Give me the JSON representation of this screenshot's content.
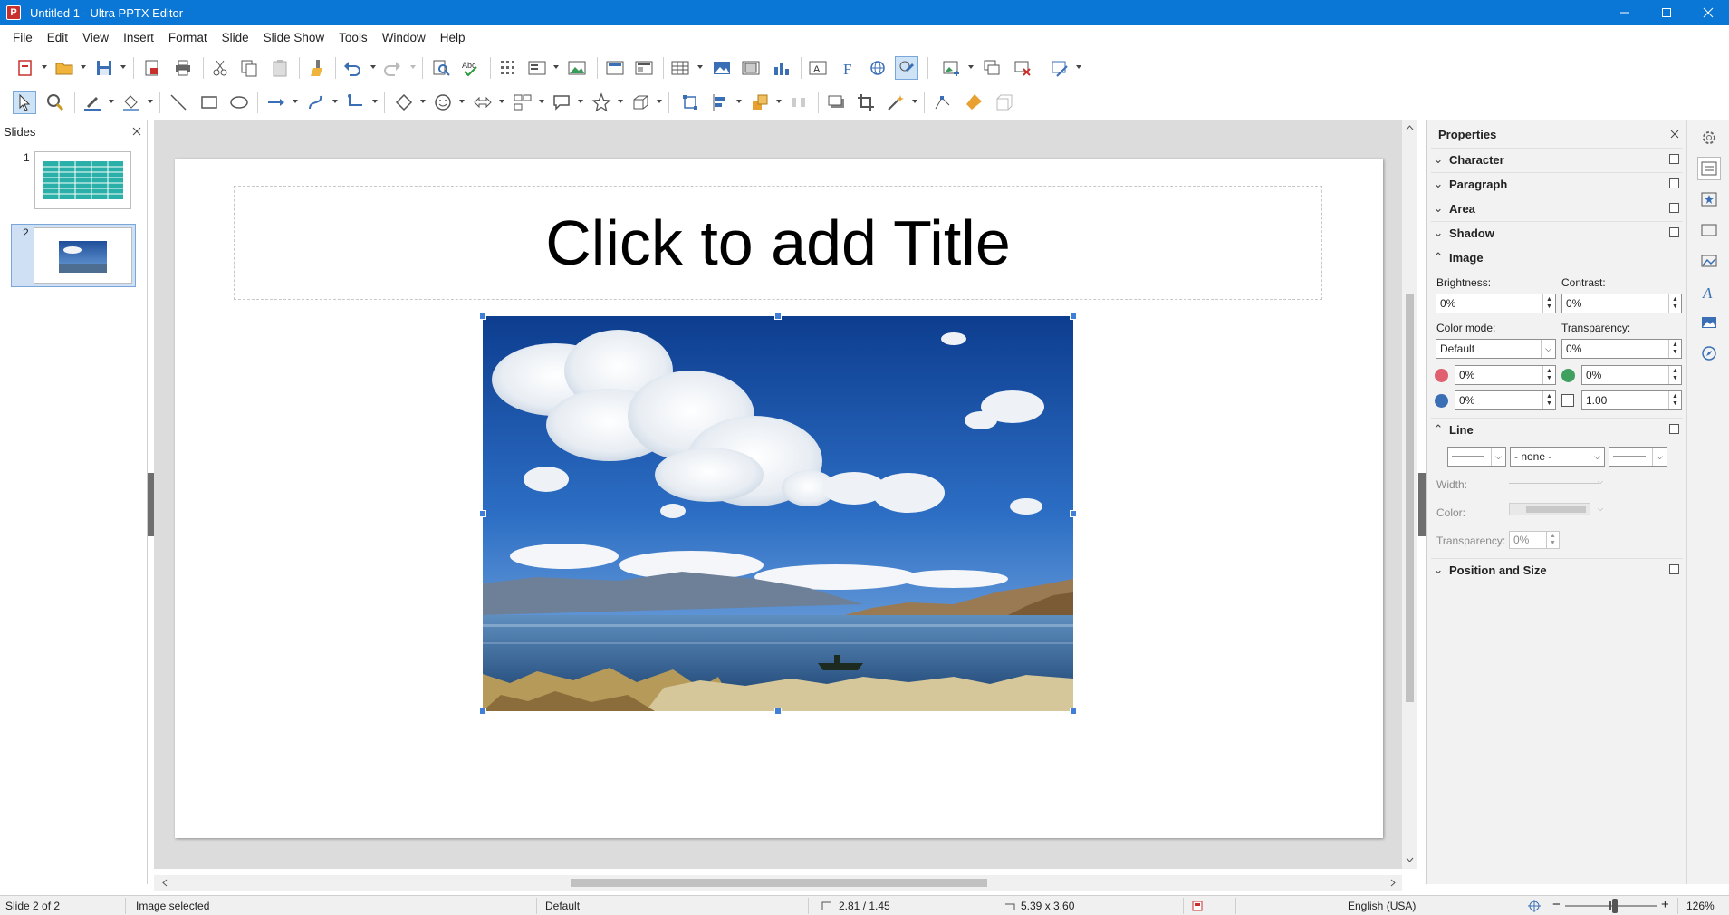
{
  "window": {
    "title": "Untitled 1 - Ultra PPTX Editor",
    "app_icon_letter": "P",
    "controls": [
      "minimize",
      "maximize",
      "close"
    ]
  },
  "menu": [
    "File",
    "Edit",
    "View",
    "Insert",
    "Format",
    "Slide",
    "Slide Show",
    "Tools",
    "Window",
    "Help"
  ],
  "slides_pane": {
    "title": "Slides",
    "slides": [
      {
        "number": "1",
        "content": "table"
      },
      {
        "number": "2",
        "content": "image",
        "selected": true
      }
    ]
  },
  "slide": {
    "title_placeholder": "Click to add Title",
    "image": "lake landscape with clouds and boat"
  },
  "properties": {
    "title": "Properties",
    "sections": {
      "character": "Character",
      "paragraph": "Paragraph",
      "area": "Area",
      "shadow": "Shadow",
      "image": "Image",
      "line": "Line",
      "position_size": "Position and Size"
    },
    "image": {
      "brightness_label": "Brightness:",
      "brightness": "0%",
      "contrast_label": "Contrast:",
      "contrast": "0%",
      "color_mode_label": "Color mode:",
      "color_mode": "Default",
      "transparency_label": "Transparency:",
      "transparency": "0%",
      "red": "0%",
      "green": "0%",
      "blue": "0%",
      "gamma": "1.00"
    },
    "line": {
      "style": "- none -",
      "width_label": "Width:",
      "color_label": "Color:",
      "transparency_label": "Transparency:",
      "transparency": "0%"
    }
  },
  "status": {
    "slide": "Slide 2 of 2",
    "selection": "Image selected",
    "master": "Default",
    "position": "2.81 / 1.45",
    "size": "5.39 x 3.60",
    "language": "English (USA)",
    "zoom": "126%"
  },
  "colors": {
    "titlebar": "#0a77d6",
    "selection_handle": "#3f7fd8",
    "accent_red": "#c8302e"
  }
}
